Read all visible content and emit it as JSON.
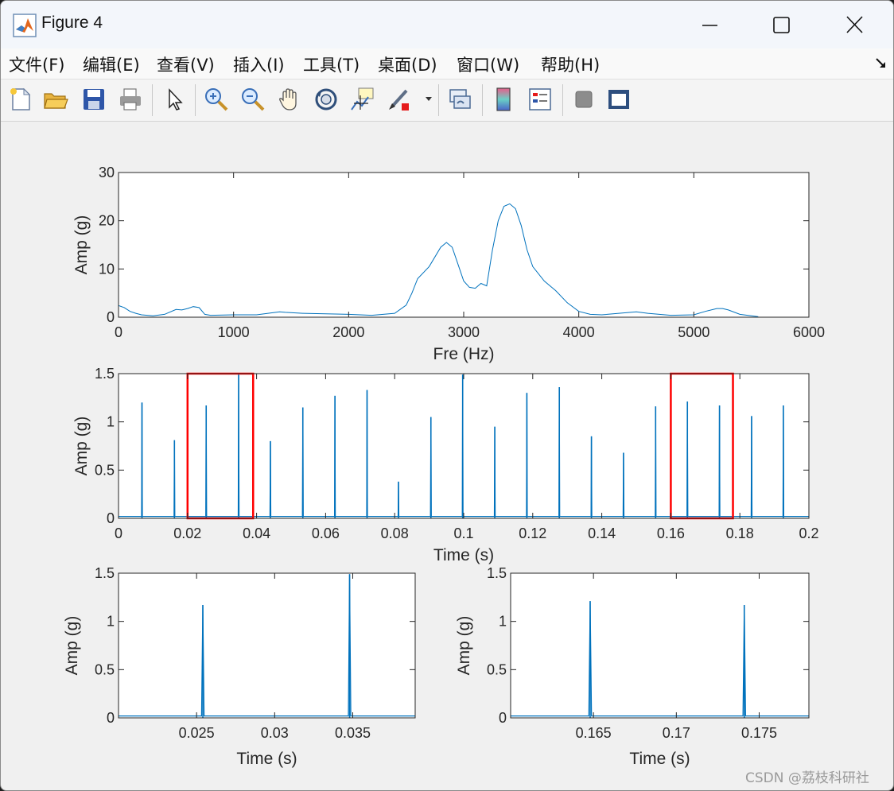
{
  "window": {
    "title": "Figure 4"
  },
  "menu": [
    {
      "label": "文件(F)"
    },
    {
      "label": "编辑(E)"
    },
    {
      "label": "查看(V)"
    },
    {
      "label": "插入(I)"
    },
    {
      "label": "工具(T)"
    },
    {
      "label": "桌面(D)"
    },
    {
      "label": "窗口(W)"
    },
    {
      "label": "帮助(H)"
    }
  ],
  "toolbar": {
    "icons": [
      "new-figure-icon",
      "open-file-icon",
      "save-icon",
      "print-icon",
      "select-arrow-icon",
      "zoom-in-icon",
      "zoom-out-icon",
      "pan-hand-icon",
      "rotate-3d-icon",
      "data-cursor-icon",
      "brush-icon",
      "link-plot-icon",
      "colorbar-icon",
      "legend-icon",
      "hide-plot-tools-icon",
      "show-plot-tools-icon"
    ]
  },
  "colors": {
    "line": "#0072bd",
    "highlight": "#ff0000"
  },
  "chart_data": [
    {
      "type": "line",
      "xlabel": "Fre (Hz)",
      "ylabel": "Amp (g)",
      "xlim": [
        0,
        6000
      ],
      "ylim": [
        0,
        30
      ],
      "xticks": [
        "0",
        "1000",
        "2000",
        "3000",
        "4000",
        "5000",
        "6000"
      ],
      "yticks": [
        "0",
        "10",
        "20",
        "30"
      ],
      "x": [
        0,
        50,
        100,
        150,
        200,
        300,
        400,
        500,
        550,
        600,
        650,
        700,
        750,
        800,
        1000,
        1200,
        1400,
        1450,
        1600,
        2000,
        2200,
        2400,
        2500,
        2550,
        2600,
        2700,
        2800,
        2850,
        2900,
        2950,
        3000,
        3050,
        3100,
        3150,
        3200,
        3250,
        3300,
        3350,
        3400,
        3450,
        3500,
        3550,
        3600,
        3700,
        3800,
        3900,
        4000,
        4100,
        4200,
        4500,
        4600,
        4800,
        5000,
        5100,
        5200,
        5250,
        5300,
        5400,
        5500,
        5560
      ],
      "y": [
        2.4,
        2.0,
        1.2,
        0.8,
        0.5,
        0.3,
        0.6,
        1.6,
        1.5,
        1.8,
        2.2,
        2.0,
        0.6,
        0.4,
        0.5,
        0.5,
        1.1,
        1.0,
        0.8,
        0.6,
        0.4,
        0.8,
        2.5,
        5.0,
        8.0,
        10.5,
        14.5,
        15.5,
        14.5,
        11.0,
        7.5,
        6.2,
        6.0,
        7.0,
        6.5,
        14.0,
        20.0,
        23.0,
        23.5,
        22.5,
        19.0,
        14.0,
        10.5,
        7.5,
        5.5,
        3.0,
        1.2,
        0.6,
        0.5,
        1.1,
        0.8,
        0.4,
        0.5,
        1.2,
        1.8,
        1.8,
        1.5,
        0.6,
        0.3,
        0.1
      ]
    },
    {
      "type": "line",
      "xlabel": "Time (s)",
      "ylabel": "Amp (g)",
      "xlim": [
        0,
        0.2
      ],
      "ylim": [
        0,
        1.5
      ],
      "xticks": [
        "0",
        "0.02",
        "0.04",
        "0.06",
        "0.08",
        "0.1",
        "0.12",
        "0.14",
        "0.16",
        "0.18",
        "0.2"
      ],
      "yticks": [
        "0",
        "0.5",
        "1",
        "1.5"
      ],
      "impulses": [
        {
          "t": 0.0068,
          "a": 1.2
        },
        {
          "t": 0.0162,
          "a": 0.81
        },
        {
          "t": 0.0254,
          "a": 1.17
        },
        {
          "t": 0.0348,
          "a": 1.49
        },
        {
          "t": 0.044,
          "a": 0.8
        },
        {
          "t": 0.0534,
          "a": 1.15
        },
        {
          "t": 0.0627,
          "a": 1.27
        },
        {
          "t": 0.072,
          "a": 1.33
        },
        {
          "t": 0.0811,
          "a": 0.38
        },
        {
          "t": 0.0905,
          "a": 1.05
        },
        {
          "t": 0.0997,
          "a": 1.49
        },
        {
          "t": 0.109,
          "a": 0.95
        },
        {
          "t": 0.1183,
          "a": 1.3
        },
        {
          "t": 0.1277,
          "a": 1.36
        },
        {
          "t": 0.137,
          "a": 0.85
        },
        {
          "t": 0.1463,
          "a": 0.68
        },
        {
          "t": 0.1556,
          "a": 1.16
        },
        {
          "t": 0.1648,
          "a": 1.21
        },
        {
          "t": 0.1741,
          "a": 1.17
        },
        {
          "t": 0.1834,
          "a": 1.06
        },
        {
          "t": 0.1926,
          "a": 1.17
        }
      ],
      "highlight_boxes": [
        [
          0.02,
          0.039
        ],
        [
          0.16,
          0.178
        ]
      ]
    },
    {
      "type": "line",
      "xlabel": "Time (s)",
      "ylabel": "Amp (g)",
      "xlim": [
        0.02,
        0.039
      ],
      "ylim": [
        0,
        1.5
      ],
      "xticks": [
        "0.025",
        "0.03",
        "0.035"
      ],
      "xtick_values": [
        0.025,
        0.03,
        0.035
      ],
      "yticks": [
        "0",
        "0.5",
        "1",
        "1.5"
      ],
      "impulses": [
        {
          "t": 0.0254,
          "a": 1.17
        },
        {
          "t": 0.0348,
          "a": 1.49
        }
      ]
    },
    {
      "type": "line",
      "xlabel": "Time (s)",
      "ylabel": "Amp (g)",
      "xlim": [
        0.16,
        0.178
      ],
      "ylim": [
        0,
        1.5
      ],
      "xticks": [
        "0.165",
        "0.17",
        "0.175"
      ],
      "xtick_values": [
        0.165,
        0.17,
        0.175
      ],
      "yticks": [
        "0",
        "0.5",
        "1",
        "1.5"
      ],
      "impulses": [
        {
          "t": 0.1648,
          "a": 1.21
        },
        {
          "t": 0.1741,
          "a": 1.17
        }
      ]
    }
  ],
  "watermark": "CSDN @荔枝科研社"
}
